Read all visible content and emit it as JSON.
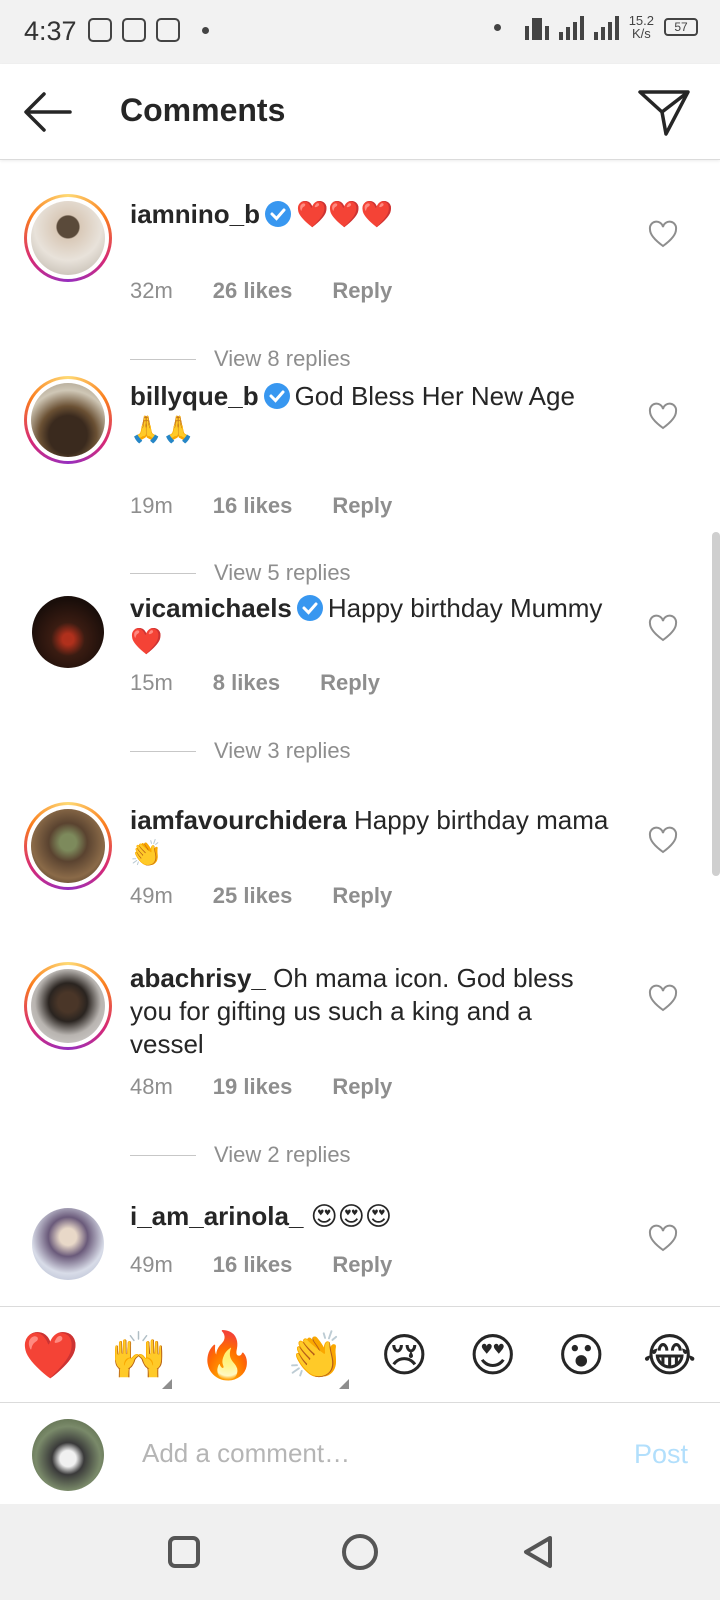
{
  "status_bar": {
    "time": "4:37",
    "speed_value": "15.2",
    "speed_unit": "K/s",
    "battery": "57"
  },
  "header": {
    "title": "Comments",
    "back_icon": "arrow-left-icon",
    "send_icon": "paper-plane-icon"
  },
  "comments": [
    {
      "username": "iamnino_b",
      "verified": true,
      "text": "❤️❤️❤️",
      "time": "32m",
      "likes": "26 likes",
      "reply": "Reply",
      "view_replies": "View 8 replies"
    },
    {
      "username": "billyque_b",
      "verified": true,
      "text": "God Bless Her New Age 🙏🙏",
      "time": "19m",
      "likes": "16 likes",
      "reply": "Reply",
      "view_replies": "View 5 replies"
    },
    {
      "username": "vicamichaels",
      "verified": true,
      "text": "Happy birthday Mummy ❤️",
      "time": "15m",
      "likes": "8 likes",
      "reply": "Reply",
      "view_replies": "View 3 replies"
    },
    {
      "username": "iamfavourchidera",
      "verified": false,
      "text": "Happy birthday mama 👏",
      "time": "49m",
      "likes": "25 likes",
      "reply": "Reply"
    },
    {
      "username": "abachrisy_",
      "verified": false,
      "text": "Oh mama icon. God bless you for gifting us such a king and a vessel",
      "time": "48m",
      "likes": "19 likes",
      "reply": "Reply",
      "view_replies": "View 2 replies"
    },
    {
      "username": "i_am_arinola_",
      "verified": false,
      "text": "😍😍😍",
      "time": "49m",
      "likes": "16 likes",
      "reply": "Reply"
    }
  ],
  "emoji_bar": [
    "❤️",
    "🙌",
    "🔥",
    "👏",
    "😢",
    "😍",
    "😮",
    "😂"
  ],
  "comment_input": {
    "placeholder": "Add a comment…",
    "post_label": "Post"
  },
  "colors": {
    "accent_blue": "#3897f0",
    "post_disabled": "#b2dffc",
    "meta_grey": "#8e8e8e"
  }
}
